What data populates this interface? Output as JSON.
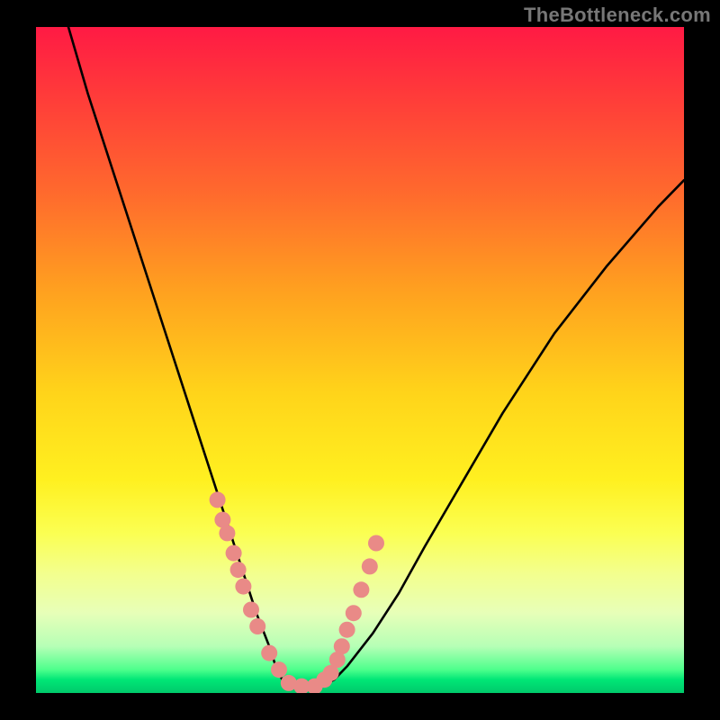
{
  "watermark": "TheBottleneck.com",
  "chart_data": {
    "type": "line",
    "title": "",
    "xlabel": "",
    "ylabel": "",
    "xlim": [
      0,
      100
    ],
    "ylim": [
      0,
      100
    ],
    "grid": false,
    "legend": false,
    "annotations": [],
    "series": [
      {
        "name": "bottleneck-curve",
        "color": "#000000",
        "x": [
          5,
          8,
          12,
          16,
          20,
          24,
          28,
          30,
          32,
          34,
          36,
          37,
          38,
          39,
          40,
          42,
          44,
          46,
          48,
          52,
          56,
          60,
          66,
          72,
          80,
          88,
          96,
          100
        ],
        "y": [
          100,
          90,
          78,
          66,
          54,
          42,
          30,
          24,
          18,
          12,
          7,
          4,
          2,
          1,
          1,
          1,
          1,
          2,
          4,
          9,
          15,
          22,
          32,
          42,
          54,
          64,
          73,
          77
        ]
      }
    ],
    "markers": [
      {
        "name": "scatter-points",
        "color": "#e98a87",
        "radius_px": 9,
        "x": [
          28.0,
          28.8,
          29.5,
          30.5,
          31.2,
          32.0,
          33.2,
          34.2,
          36.0,
          37.5,
          39.0,
          41.0,
          43.0,
          44.5,
          45.5,
          46.5,
          47.2,
          48.0,
          49.0,
          50.2,
          51.5,
          52.5
        ],
        "y": [
          29.0,
          26.0,
          24.0,
          21.0,
          18.5,
          16.0,
          12.5,
          10.0,
          6.0,
          3.5,
          1.5,
          1.0,
          1.0,
          2.0,
          3.0,
          5.0,
          7.0,
          9.5,
          12.0,
          15.5,
          19.0,
          22.5
        ]
      }
    ]
  }
}
